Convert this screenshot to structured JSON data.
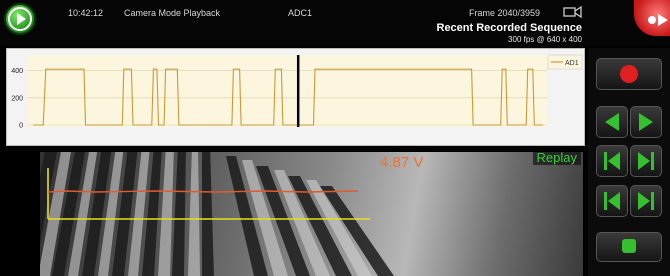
{
  "topbar": {
    "time": "10:42:12",
    "mode": "Camera Mode Playback",
    "channel": "ADC1",
    "frame": "Frame 2040/3959",
    "title": "Recent Recorded Sequence",
    "subtitle": "300 fps @ 640 x 400"
  },
  "colors": {
    "accent_green": "#2e9a26",
    "record_red": "#e02020",
    "signal": "#c89a3a",
    "overlay_line": "#e05a30",
    "overlay_axis": "#e8e020"
  },
  "video": {
    "replay_label": "Replay",
    "voltage_readout": "4.87 V"
  },
  "controls": {
    "icons": [
      "record-icon",
      "step-back-icon",
      "step-forward-icon",
      "frame-back-icon",
      "frame-forward-icon",
      "skip-start-icon",
      "skip-end-icon",
      "stop-icon"
    ]
  },
  "chart_data": {
    "type": "line",
    "series": [
      {
        "name": "AD1",
        "x": [
          0,
          2,
          2.5,
          10,
          10.3,
          17.5,
          17.8,
          19.3,
          19.6,
          23.3,
          23.6,
          24.3,
          24.6,
          25.7,
          26,
          28.3,
          28.6,
          29,
          29.3,
          39,
          39.3,
          40.5,
          40.8,
          47.2,
          47.5,
          48.7,
          49,
          55,
          55.3,
          86,
          86.3,
          91.7,
          92,
          92.7,
          93,
          96.7,
          97,
          98,
          98.3,
          100
        ],
        "y": [
          0,
          0,
          410,
          410,
          0,
          0,
          410,
          410,
          0,
          0,
          410,
          410,
          0,
          0,
          410,
          410,
          0,
          0,
          0,
          0,
          410,
          410,
          0,
          0,
          410,
          410,
          0,
          0,
          410,
          410,
          0,
          0,
          410,
          410,
          0,
          0,
          410,
          410,
          0,
          0
        ]
      }
    ],
    "yticks": [
      0,
      200,
      400
    ],
    "ylim": [
      0,
      500
    ],
    "xlim": [
      0,
      100
    ],
    "cursor_x": 52,
    "grid": true,
    "legend": "top-right"
  }
}
